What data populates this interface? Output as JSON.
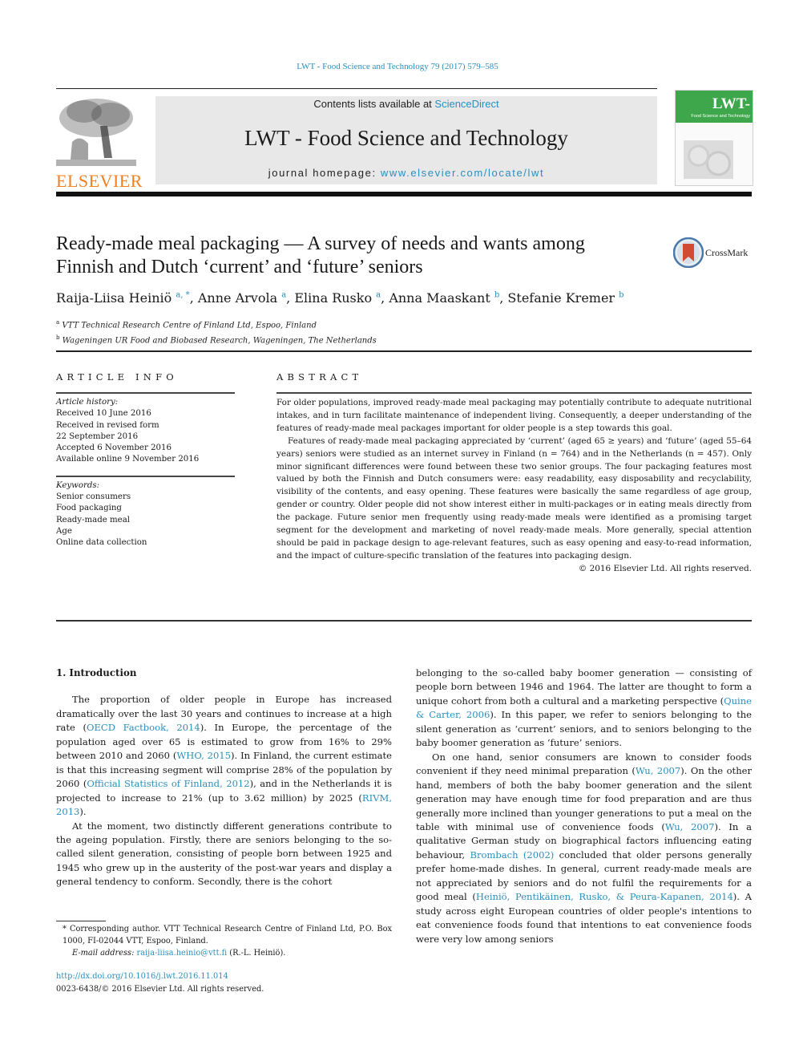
{
  "running_head": "LWT - Food Science and Technology 79 (2017) 579–585",
  "header": {
    "publisher_logo_text": "ELSEVIER",
    "contents_prefix": "Contents lists available at ",
    "contents_link": "ScienceDirect",
    "journal_title": "LWT - Food Science and Technology",
    "homepage_prefix": "journal homepage: ",
    "homepage_link": "www.elsevier.com/locate/lwt",
    "cover": {
      "title": "LWT-",
      "subtitle": "Food Science and Technology"
    },
    "colors": {
      "link": "#2a8fbd",
      "elsevier_orange": "#f07f1e",
      "cover_green": "#3ea74b",
      "band_gray": "#e8e8e8"
    }
  },
  "article": {
    "title_line1": "Ready-made meal packaging — A survey of needs and wants among",
    "title_line2": "Finnish and Dutch ‘current’ and ‘future’ seniors",
    "crossmark_label": "CrossMark",
    "authors": [
      {
        "name": "Raija-Liisa Heiniö",
        "sup": "a, *"
      },
      {
        "name": "Anne Arvola",
        "sup": "a"
      },
      {
        "name": "Elina Rusko",
        "sup": "a"
      },
      {
        "name": "Anna Maaskant",
        "sup": "b"
      },
      {
        "name": "Stefanie Kremer",
        "sup": "b"
      }
    ],
    "affiliations": [
      {
        "mark": "a",
        "text": "VTT Technical Research Centre of Finland Ltd, Espoo, Finland"
      },
      {
        "mark": "b",
        "text": "Wageningen UR Food and Biobased Research, Wageningen, The Netherlands"
      }
    ]
  },
  "article_info": {
    "heading": "ARTICLE INFO",
    "history_label": "Article history:",
    "history": [
      "Received 10 June 2016",
      "Received in revised form",
      "22 September 2016",
      "Accepted 6 November 2016",
      "Available online 9 November 2016"
    ],
    "keywords_label": "Keywords:",
    "keywords": [
      "Senior consumers",
      "Food packaging",
      "Ready-made meal",
      "Age",
      "Online data collection"
    ]
  },
  "abstract": {
    "heading": "ABSTRACT",
    "paragraphs": [
      "For older populations, improved ready-made meal packaging may potentially contribute to adequate nutritional intakes, and in turn facilitate maintenance of independent living. Consequently, a deeper understanding of the features of ready-made meal packages important for older people is a step towards this goal.",
      "Features of ready-made meal packaging appreciated by ‘current’ (aged 65 ≥ years) and ‘future’ (aged 55–64 years) seniors were studied as an internet survey in Finland (n = 764) and in the Netherlands (n = 457). Only minor significant differences were found between these two senior groups. The four packaging features most valued by both the Finnish and Dutch consumers were: easy readability, easy disposability and recyclability, visibility of the contents, and easy opening. These features were basically the same regardless of age group, gender or country. Older people did not show interest either in multi-packages or in eating meals directly from the package. Future senior men frequently using ready-made meals were identified as a promising target segment for the development and marketing of novel ready-made meals. More generally, special attention should be paid in package design to age-relevant features, such as easy opening and easy-to-read information, and the impact of culture-specific translation of the features into packaging design."
    ],
    "copyright": "© 2016 Elsevier Ltd. All rights reserved."
  },
  "body": {
    "section_heading": "1.  Introduction",
    "left": {
      "p1": {
        "t1": "The proportion of older people in Europe has increased dramatically over the last 30 years and continues to increase at a high rate (",
        "r1": "OECD Factbook, 2014",
        "t2": "). In Europe, the percentage of the population aged over 65 is estimated to grow from 16% to 29% between 2010 and 2060 (",
        "r2": "WHO, 2015",
        "t3": "). In Finland, the current es­timate is that this increasing segment will comprise 28% of the population by 2060 (",
        "r3": "Official Statistics of Finland, 2012",
        "t4": "), and in the Netherlands it is projected to increase to 21% (up to 3.62 million) by 2025 (",
        "r4": "RIVM, 2013",
        "t5": ")."
      },
      "p2": "At the moment, two distinctly different generations contribute to the ageing population. Firstly, there are seniors belonging to the so-called silent generation, consisting of people born between 1925 and 1945 who grew up in the austerity of the post-war years and display a general tendency to conform. Secondly, there is the cohort"
    },
    "right": {
      "p1": {
        "t1": "belonging to the so-called baby boomer generation — consisting of people born between 1946 and 1964. The latter are thought to form a unique cohort from both a cultural and a marketing perspective (",
        "r1": "Quine & Carter, 2006",
        "t2": "). In this paper, we refer to seniors belonging to the silent generation as ‘current’ seniors, and to seniors belonging to the baby boomer generation as ‘future’ seniors."
      },
      "p2": {
        "t1": "On one hand, senior consumers are known to consider foods convenient if they need minimal preparation (",
        "r1": "Wu, 2007",
        "t2": "). On the other hand, members of both the baby boomer generation and the silent generation may have enough time for food preparation and are thus generally more inclined than younger generations to put a meal on the table with minimal use of convenience foods (",
        "r2": "Wu, 2007",
        "t3": "). In a qualitative German study on biographical factors influencing eating behaviour, ",
        "r3": "Brombach (2002)",
        "t4": " concluded that older persons generally prefer home-made dishes. In general, cur­rent ready-made meals are not appreciated by seniors and do not fulfil the requirements for a good meal (",
        "r4": "Heiniö, Pentikäinen, Rusko, & Peura-Kapanen, 2014",
        "t5": "). A study across eight European countries of older people's intentions to eat convenience foods found that intentions to eat convenience foods were very low among seniors"
      }
    }
  },
  "footnote": {
    "corresponding": "* Corresponding author. VTT Technical Research Centre of Finland Ltd, P.O. Box 1000, FI-02044 VTT, Espoo, Finland.",
    "email_label": "E-mail address: ",
    "email": "raija-liisa.heinio@vtt.fi",
    "email_suffix": " (R.-L. Heiniö).",
    "doi": "http://dx.doi.org/10.1016/j.lwt.2016.11.014",
    "issn_copyright": "0023-6438/© 2016 Elsevier Ltd. All rights reserved."
  }
}
